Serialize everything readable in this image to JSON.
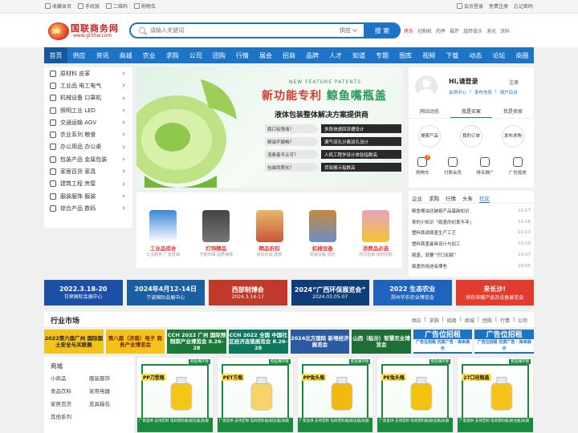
{
  "topbar": {
    "left": [
      "收藏本页",
      "手机版",
      "二维码",
      "购物车"
    ],
    "right": [
      "会员登录",
      "免费注册",
      "忘记密码"
    ]
  },
  "logo": {
    "name": "国联商务网",
    "url": "www.gl35w.com",
    "badge": "国联"
  },
  "search": {
    "placeholder": "请输入关键词",
    "category": "供应",
    "button": "搜 索"
  },
  "hotwords": [
    "烤条",
    "切割机",
    "肉亭",
    "福芹",
    "旋转接头",
    "测光",
    "涂料"
  ],
  "nav": [
    "首页",
    "供应",
    "资讯",
    "商城",
    "农业",
    "求购",
    "公司",
    "团购",
    "行情",
    "展会",
    "招商",
    "品牌",
    "人才",
    "知道",
    "专题",
    "图库",
    "视频",
    "下载",
    "动态",
    "论坛",
    "商圈"
  ],
  "categories": [
    "原材料 皮革",
    "工业品 电工电气",
    "机械设备 口罩机",
    "照明工业 LED",
    "交通运输 AGV",
    "农业系列 粮食",
    "办公用品 办公桌",
    "包装产品 金属包装",
    "家居百货 家具",
    "建筑工程 房屋",
    "服装服饰 服装",
    "综合产品 数码"
  ],
  "banner": {
    "patent": "NEW FEATURE PATENTS",
    "title_red": "新功能专利",
    "title_green": "鲸鱼嘴瓶盖",
    "subtitle": "液体包装整体解决方案提供商",
    "rows": [
      {
        "q": "瓶口有残液？",
        "a": "多段快速回流槽设计"
      },
      {
        "q": "倒油不顺畅？",
        "a": "满气双孔分离双孔设计"
      },
      {
        "q": "消费者不认可？",
        "a": "人机工程学设计体验指数高"
      },
      {
        "q": "包装同质化？",
        "a": "货架展示指数高"
      }
    ]
  },
  "products": [
    {
      "t": "工业品综合",
      "s": "工业制剂 厂家直销"
    },
    {
      "t": "灯饰精品",
      "s": "节能环保 品质保障"
    },
    {
      "t": "精品折扣",
      "s": "折扣大促 选购"
    },
    {
      "t": "机械设备",
      "s": "机械设备 供应"
    },
    {
      "t": "消费品必选",
      "s": "共同直销 限时抢购"
    }
  ],
  "user": {
    "greeting": "Hi,请登录",
    "register": "注册",
    "links": [
      "会员中心",
      "发布信息",
      "商户后台"
    ],
    "tabs": [
      "网站动态",
      "我是买家",
      "我是卖家"
    ],
    "circles": [
      "搜索产品",
      "我的订单",
      "发布求购"
    ],
    "icons": [
      {
        "label": "购物车",
        "badge": "0"
      },
      {
        "label": "付费会员"
      },
      {
        "label": "排名推广"
      },
      {
        "label": "广告投放"
      }
    ]
  },
  "news": {
    "tabs": [
      "企业",
      "求购",
      "行情",
      "头条",
      "社区"
    ],
    "items": [
      {
        "title": "鲸鱼嘴油还破瓶产品基础知识",
        "date": "10-17"
      },
      {
        "title": "茶的小知识「瓶盖的初衷不寻」",
        "date": "10-16"
      },
      {
        "title": "塑料瓶滤瓶盖生产工艺",
        "date": "10-13"
      },
      {
        "title": "塑料瓶盖最具设计与加工",
        "date": "10-10"
      },
      {
        "title": "瓶盖，就要“守口如瓶”",
        "date": "10-07"
      },
      {
        "title": "瓶盖的用途有哪些",
        "date": "10-05"
      }
    ]
  },
  "ads": [
    {
      "l1": "2022.3.18-20",
      "l2": "甘肃国际会展中心",
      "color": "#1b4fa8"
    },
    {
      "l1": "2024年4月12-14日",
      "l2": "宁波国际会展中心",
      "color": "#1a5ea3"
    },
    {
      "l1": "西部制博会",
      "l2": "2024.3.14-17",
      "color": "#c0392b"
    },
    {
      "l1": "2024“广西环保展览会”",
      "l2": "2024.03.05-07",
      "color": "#0d3e7a"
    },
    {
      "l1": "2022 生态农业",
      "l2": "郑州华农农业博览会",
      "color": "#1f63c0"
    },
    {
      "l1": "来长沙!",
      "l2": "供热采暖产品及设备展览会",
      "color": "#e33b2e"
    }
  ],
  "market": {
    "title": "行业市场",
    "links": [
      "供应",
      "求购",
      "招商",
      "商城",
      "团购",
      "行情",
      "公司"
    ],
    "ads": [
      {
        "text": "2022第六届广州 国际国土安全与关联展",
        "bg": "#f4c31a",
        "fg": "#222"
      },
      {
        "text": "第八届（济南）电子 商务产业博览会",
        "bg": "#f4c31a",
        "fg": "#7a1c0f"
      },
      {
        "text": "CCH 2022 广州 国际预制菜产业博览会 8.26-28",
        "bg": "#1a7a3a",
        "fg": "#fff"
      },
      {
        "text": "CCH 2022 全国 中国社区经济连锁展览会 8.26-28",
        "bg": "#0d7a5e",
        "fg": "#fff"
      },
      {
        "text": "2024北方国际 新增经济展览会",
        "bg": "#2c5aa0",
        "fg": "#fff"
      },
      {
        "text": "山西（临汾）智慧农业博览会",
        "bg": "#1d6e37",
        "fg": "#fff"
      },
      {
        "zl": true,
        "big": "广告位招租",
        "sm": "广告位招租 优质广告  ·  库来展示"
      },
      {
        "zl": true,
        "big": "广告位招租",
        "sm": "广告位招租 优质广告  ·  库来展示"
      }
    ],
    "left_head": "商城",
    "left_items": [
      "小商品",
      "服装服饰",
      "食品饮料",
      "家用电器",
      "家居百货",
      "皮具箱包",
      "其他系列"
    ],
    "products": [
      {
        "name": "PP刀型瓶",
        "bot": "厂家直供 支持定制 电商塑料瓶|耐压瓶|防漏",
        "brand": "鲸鱼嘴环保"
      },
      {
        "name": "PET方瓶",
        "bot": "厂家直供 支持定制 电商塑料瓶|耐压瓶|防漏",
        "brand": "鲸鱼嘴环保"
      },
      {
        "name": "PP兔头瓶",
        "bot": "厂家直供 支持定制 电商塑料瓶|耐压瓶|防漏",
        "brand": "鲸鱼嘴环保"
      },
      {
        "name": "PE兔头瓶",
        "bot": "厂家直供 支持定制 电商塑料瓶|耐压瓶|防漏",
        "brand": "鲸鱼嘴环保"
      },
      {
        "name": "27口径瓶盖",
        "bot": "厂家直供 支持定制 电商塑料瓶|耐压瓶|防漏",
        "brand": "鲸鱼嘴环保"
      }
    ]
  },
  "colors": {
    "accent": "#1c74c9",
    "red": "#d83a2b",
    "green": "#1a8a3e"
  }
}
